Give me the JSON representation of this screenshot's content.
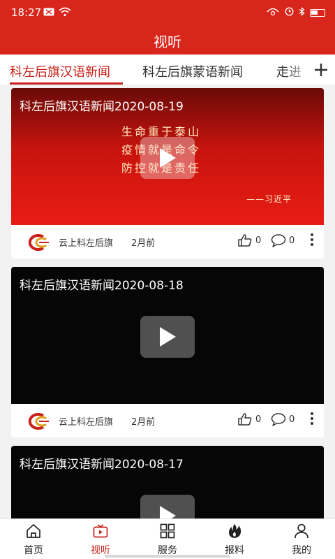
{
  "status_bar": {
    "time": "18:27",
    "left_icons": [
      "message-icon",
      "wifi-icon"
    ],
    "right_icons": [
      "signal-icon",
      "alarm-icon",
      "bluetooth-icon",
      "battery-icon"
    ]
  },
  "header": {
    "title": "视听"
  },
  "tabs": {
    "items": [
      {
        "label": "科左后旗汉语新闻",
        "active": true
      },
      {
        "label": "科左后旗蒙语新闻",
        "active": false
      },
      {
        "label": "走进",
        "active": false
      }
    ],
    "add_icon": "plus-icon"
  },
  "feed": {
    "items": [
      {
        "title": "科左后旗汉语新闻2020-08-19",
        "poster_lines": [
          "生命重于泰山",
          "疫情就是命令",
          "防控就是责任"
        ],
        "poster_signature": "——习近平",
        "source": "云上科左后旗",
        "time_ago": "2月前",
        "likes": "0",
        "comments": "0"
      },
      {
        "title": "科左后旗汉语新闻2020-08-18",
        "source": "云上科左后旗",
        "time_ago": "2月前",
        "likes": "0",
        "comments": "0"
      },
      {
        "title": "科左后旗汉语新闻2020-08-17"
      }
    ]
  },
  "bottom_nav": {
    "items": [
      {
        "label": "首页",
        "icon": "home-icon",
        "active": false
      },
      {
        "label": "视听",
        "icon": "tv-icon",
        "active": true
      },
      {
        "label": "服务",
        "icon": "grid-icon",
        "active": false
      },
      {
        "label": "报料",
        "icon": "flame-icon",
        "active": false
      },
      {
        "label": "我的",
        "icon": "user-icon",
        "active": false
      }
    ]
  },
  "colors": {
    "brand_red": "#d9261c",
    "active_tab": "#c8221a"
  }
}
